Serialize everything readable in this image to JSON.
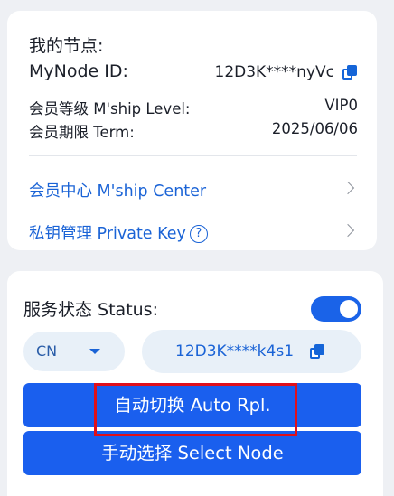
{
  "node_card": {
    "title": "我的节点:",
    "node_id_label": "MyNode ID:",
    "node_id_value": "12D3K****nyVc",
    "membership_level_label": "会员等级 M'ship Level:",
    "membership_level_value": "VIP0",
    "membership_term_label": "会员期限 Term:",
    "membership_term_value": "2025/06/06",
    "links": [
      {
        "label": "会员中心 M'ship Center"
      },
      {
        "label": "私钥管理 Private Key"
      }
    ],
    "help_glyph": "?"
  },
  "service_card": {
    "status_label": "服务状态 Status:",
    "status_enabled": true,
    "region_value": "CN",
    "selected_node_value": "12D3K****k4s1",
    "auto_replace_label": "自动切换 Auto Rpl.",
    "select_node_label": "手动选择 Select Node"
  },
  "icons": [
    "copy-icon",
    "chevron-right-icon",
    "help-icon",
    "caret-down-icon"
  ],
  "colors": {
    "accent": "#1a5fee",
    "link": "#1a63d6",
    "highlight": "#e0101a"
  }
}
